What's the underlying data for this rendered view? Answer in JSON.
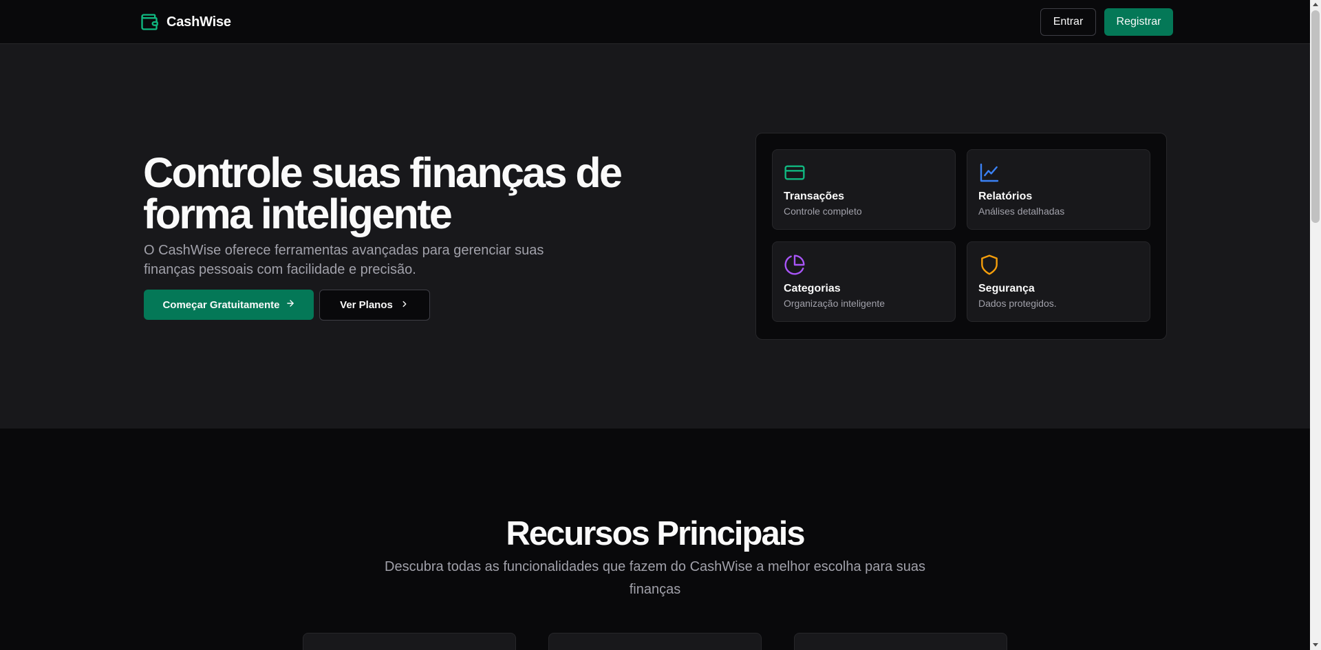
{
  "header": {
    "brand": "CashWise",
    "login_label": "Entrar",
    "register_label": "Registrar"
  },
  "hero": {
    "title_line1": "Controle suas finanças de",
    "title_line2": "forma inteligente",
    "description": "O CashWise oferece ferramentas avançadas para gerenciar suas finanças pessoais com facilidade e precisão.",
    "primary_cta": "Começar Gratuitamente",
    "secondary_cta": "Ver Planos"
  },
  "features": [
    {
      "title": "Transações",
      "subtitle": "Controle completo",
      "icon": "credit-card-icon",
      "color": "#10b981"
    },
    {
      "title": "Relatórios",
      "subtitle": "Análises detalhadas",
      "icon": "line-chart-icon",
      "color": "#3b82f6"
    },
    {
      "title": "Categorias",
      "subtitle": "Organização inteligente",
      "icon": "pie-chart-icon",
      "color": "#a855f7"
    },
    {
      "title": "Segurança",
      "subtitle": "Dados protegidos.",
      "icon": "shield-icon",
      "color": "#f59e0b"
    }
  ],
  "recursos": {
    "title": "Recursos Principais",
    "subtitle": "Descubra todas as funcionalidades que fazem do CashWise a melhor escolha para suas finanças"
  },
  "colors": {
    "accent": "#047857",
    "brand_icon": "#10b981",
    "background": "#09090b",
    "surface": "#18181b"
  }
}
